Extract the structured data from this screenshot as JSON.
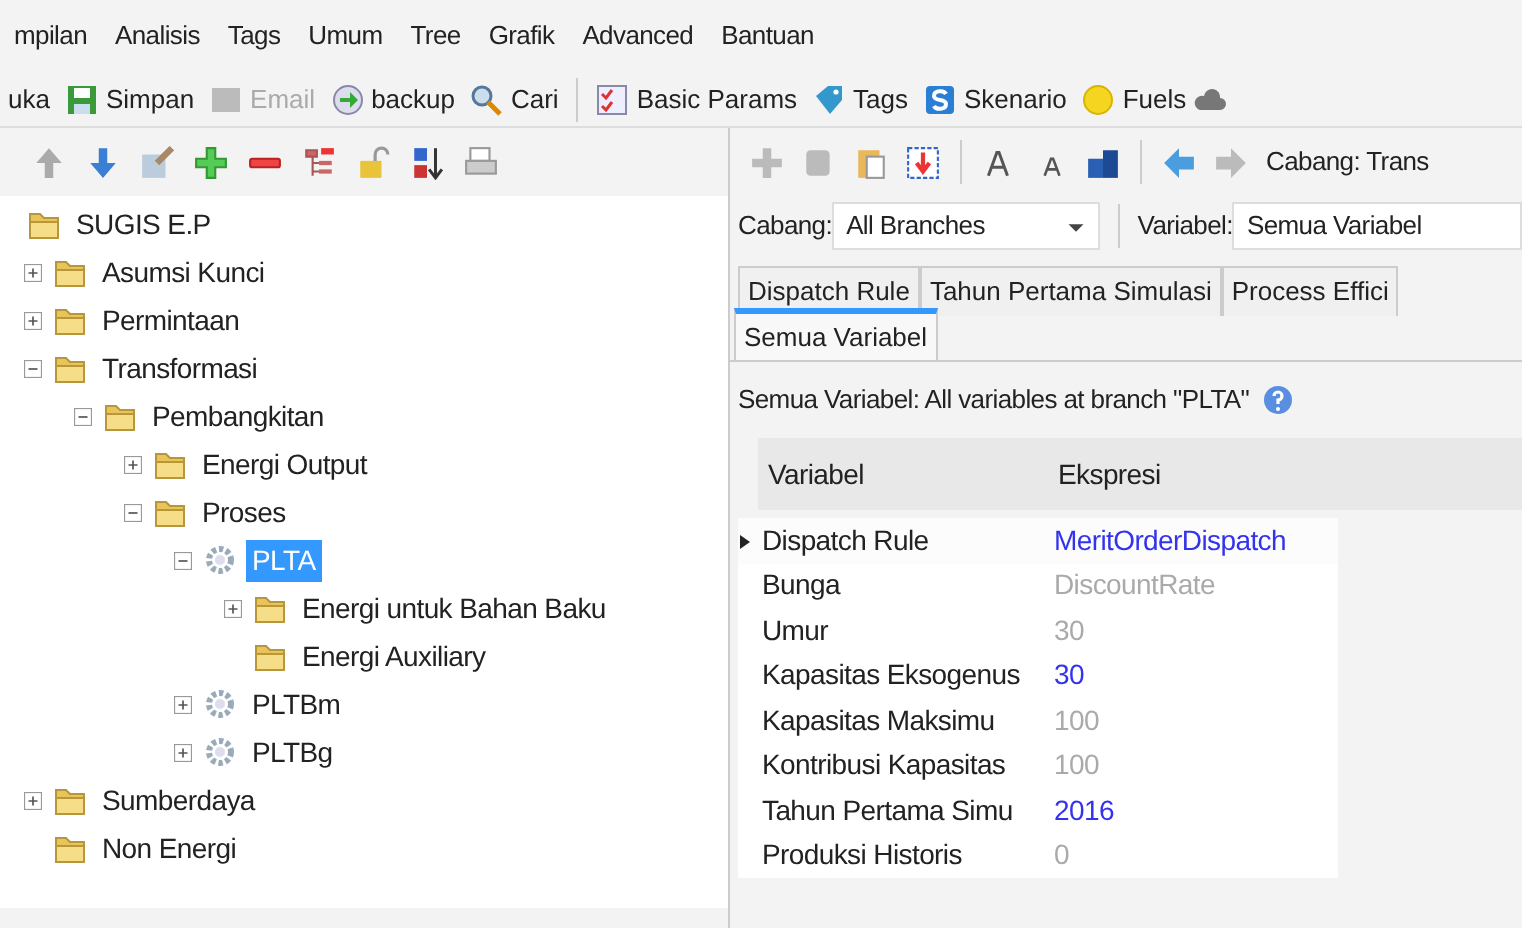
{
  "menu": [
    "mpilan",
    "Analisis",
    "Tags",
    "Umum",
    "Tree",
    "Grafik",
    "Advanced",
    "Bantuan"
  ],
  "toolbar": [
    {
      "label": "uka",
      "disabled": false
    },
    {
      "label": "Simpan",
      "disabled": false
    },
    {
      "label": "Email",
      "disabled": true
    },
    {
      "label": "backup",
      "disabled": false
    },
    {
      "label": "Cari",
      "disabled": false
    },
    {
      "label": "Basic Params",
      "disabled": false
    },
    {
      "label": "Tags",
      "disabled": false
    },
    {
      "label": "Skenario",
      "disabled": false
    },
    {
      "label": "Fuels",
      "disabled": false
    }
  ],
  "tree": [
    {
      "label": "SUGIS E.P",
      "kind": "folder",
      "selected": false,
      "children": [
        {
          "label": "Asumsi Kunci",
          "kind": "folder",
          "selected": false,
          "expanded": false
        },
        {
          "label": "Permintaan",
          "kind": "folder",
          "selected": false,
          "expanded": false
        },
        {
          "label": "Transformasi",
          "kind": "folder",
          "selected": false,
          "expanded": true,
          "children": [
            {
              "label": "Pembangkitan",
              "kind": "folder",
              "selected": false,
              "expanded": true,
              "children": [
                {
                  "label": "Energi Output",
                  "kind": "folder",
                  "selected": false,
                  "expanded": false
                },
                {
                  "label": "Proses",
                  "kind": "folder",
                  "selected": false,
                  "expanded": true,
                  "children": [
                    {
                      "label": "PLTA",
                      "kind": "gear",
                      "selected": true,
                      "expanded": true,
                      "children": [
                        {
                          "label": "Energi untuk Bahan Baku",
                          "kind": "folder",
                          "selected": false,
                          "expanded": false
                        },
                        {
                          "label": "Energi Auxiliary",
                          "kind": "folder",
                          "selected": false
                        }
                      ]
                    },
                    {
                      "label": "PLTBm",
                      "kind": "gear",
                      "selected": false,
                      "expanded": false
                    },
                    {
                      "label": "PLTBg",
                      "kind": "gear",
                      "selected": false,
                      "expanded": false
                    }
                  ]
                }
              ]
            }
          ]
        },
        {
          "label": "Sumberdaya",
          "kind": "folder",
          "selected": false,
          "expanded": false
        },
        {
          "label": "Non Energi",
          "kind": "folder",
          "selected": false
        }
      ]
    }
  ],
  "breadcrumb": "Cabang: Trans",
  "branch_filter": {
    "label": "Cabang:",
    "value": "All Branches"
  },
  "variable_filter": {
    "label": "Variabel:",
    "value": "Semua Variabel"
  },
  "tabs": [
    {
      "label": "Dispatch Rule",
      "selected": false
    },
    {
      "label": "Tahun Pertama Simulasi",
      "selected": false
    },
    {
      "label": "Process Effici",
      "selected": false
    },
    {
      "label": "Semua Variabel",
      "selected": true
    }
  ],
  "description": "Semua Variabel: All variables at branch \"PLTA\"",
  "table": {
    "columns": [
      "Variabel",
      "Ekspresi"
    ],
    "rows": [
      {
        "variable": "Dispatch Rule",
        "expression": "MeritOrderDispatch",
        "kind": "set",
        "current": true
      },
      {
        "variable": "Bunga",
        "expression": "DiscountRate",
        "kind": "default",
        "current": false
      },
      {
        "variable": "Umur",
        "expression": "30",
        "kind": "default",
        "current": false
      },
      {
        "variable": "Kapasitas Eksogenus",
        "expression": "30",
        "kind": "set",
        "current": false
      },
      {
        "variable": "Kapasitas Maksimu",
        "expression": "100",
        "kind": "default",
        "current": false
      },
      {
        "variable": "Kontribusi Kapasitas",
        "expression": "100",
        "kind": "default",
        "current": false
      },
      {
        "variable": "Tahun Pertama Simu",
        "expression": "2016",
        "kind": "set",
        "current": false
      },
      {
        "variable": "Produksi Historis",
        "expression": "0",
        "kind": "default",
        "current": false
      }
    ]
  }
}
